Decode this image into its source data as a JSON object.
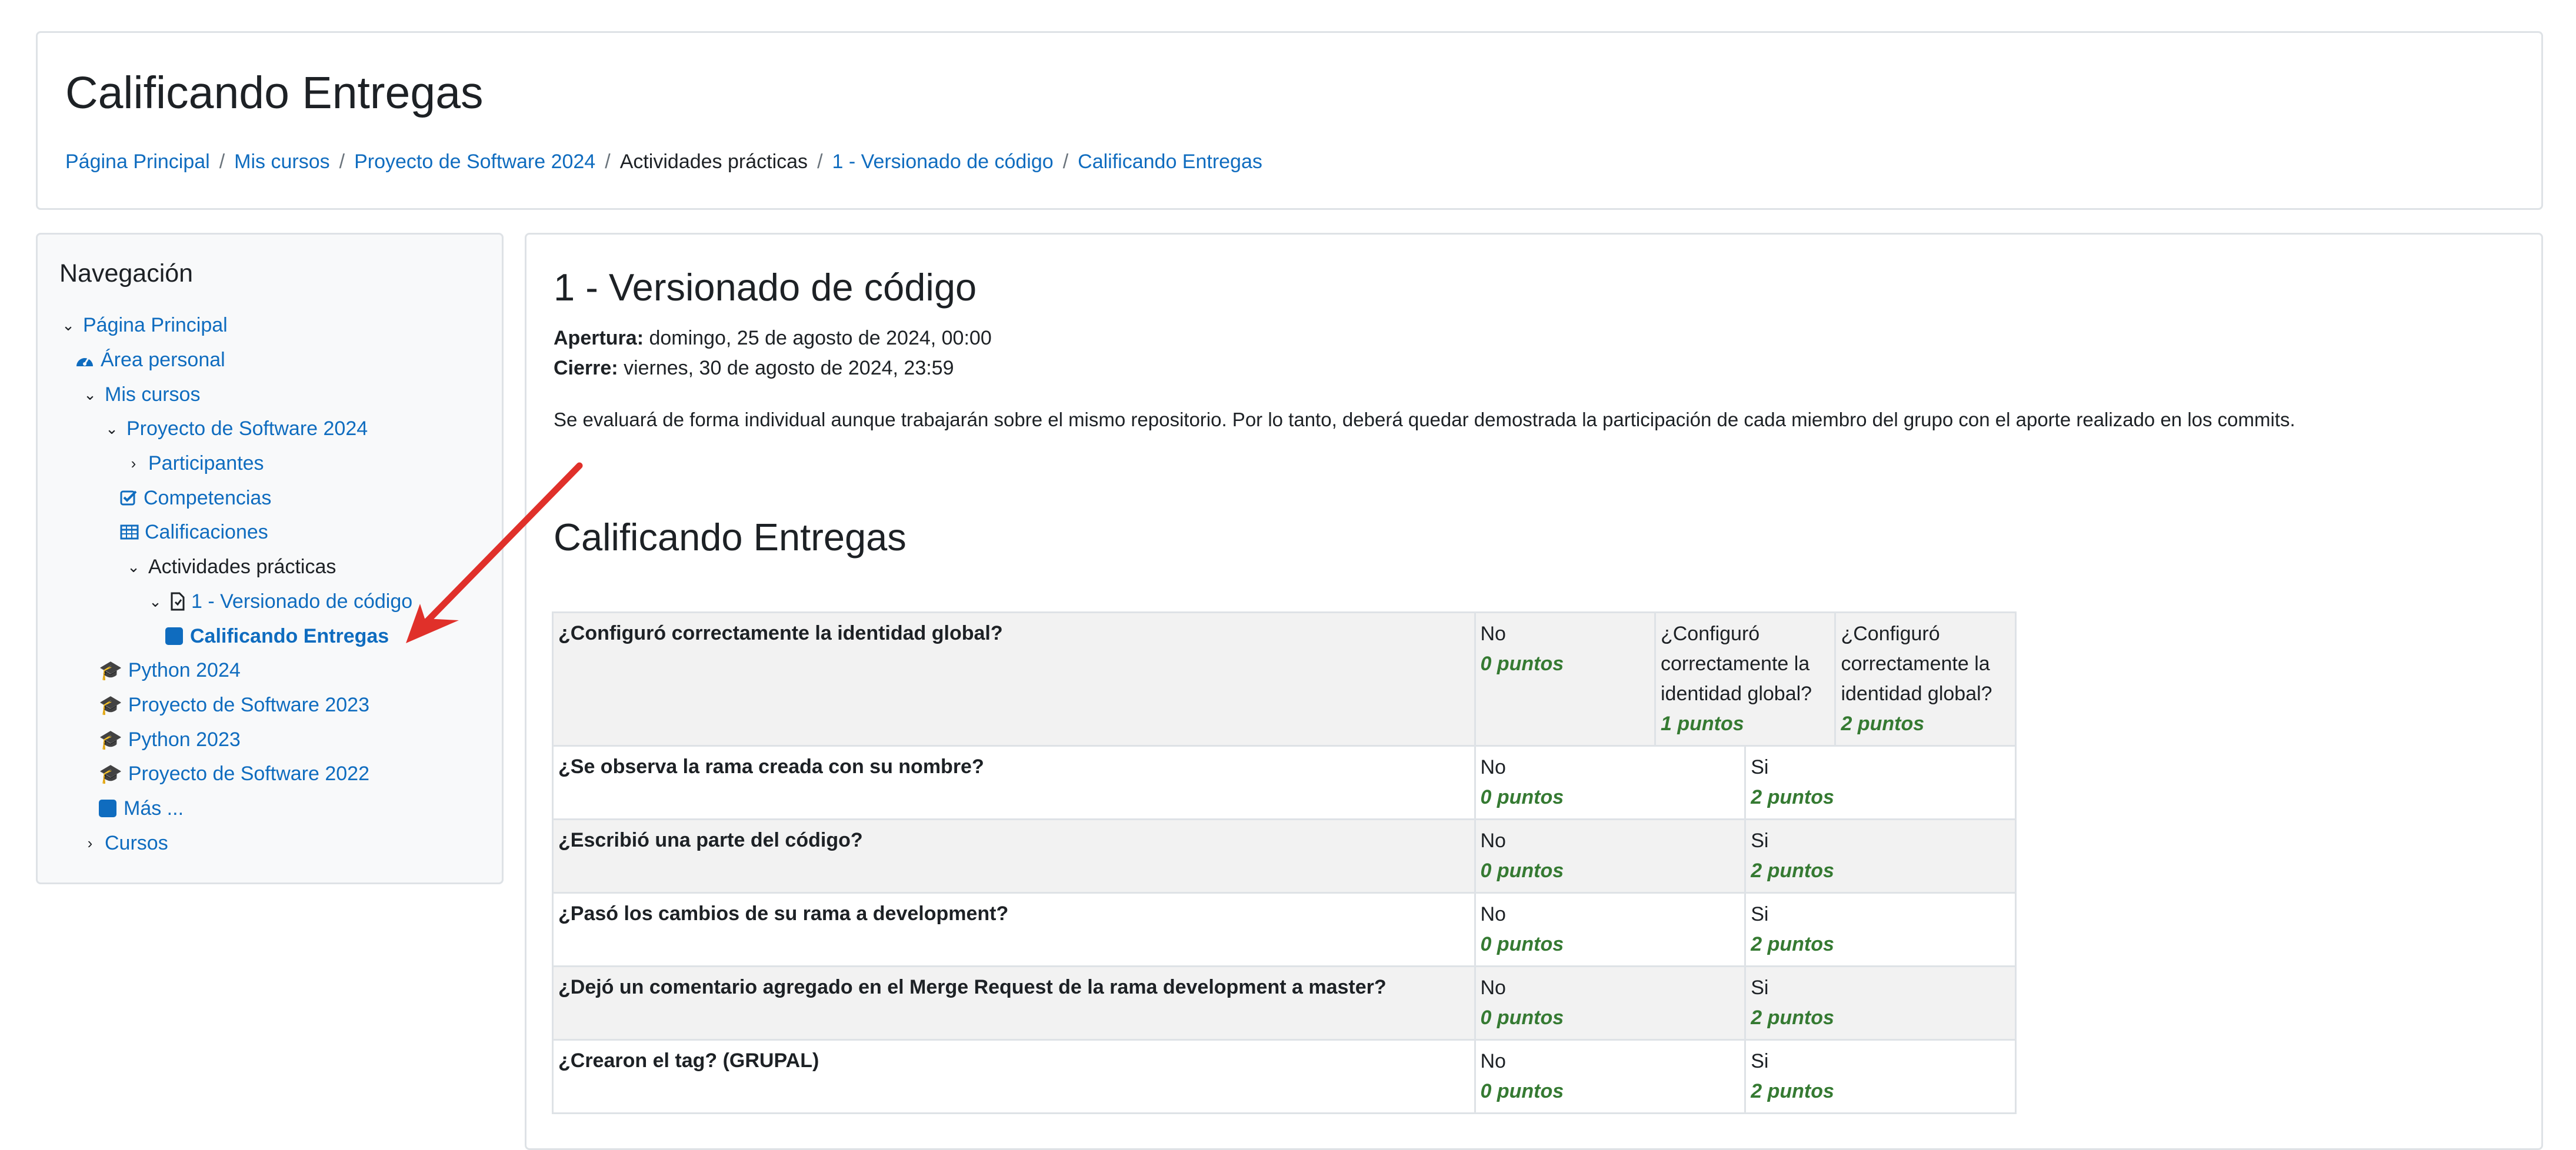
{
  "header": {
    "title": "Calificando Entregas",
    "breadcrumb": [
      {
        "label": "Página Principal",
        "link": true
      },
      {
        "label": "Mis cursos",
        "link": true
      },
      {
        "label": "Proyecto de Software 2024",
        "link": true
      },
      {
        "label": "Actividades prácticas",
        "link": false
      },
      {
        "label": "1 - Versionado de código",
        "link": true
      },
      {
        "label": "Calificando Entregas",
        "link": true
      }
    ]
  },
  "navigation": {
    "title": "Navegación",
    "items": [
      {
        "label": "Página Principal",
        "icon": "chevron-down-icon"
      },
      {
        "label": "Área personal",
        "icon": "dashboard-icon"
      },
      {
        "label": "Mis cursos",
        "icon": "chevron-down-icon"
      },
      {
        "label": "Proyecto de Software 2024",
        "icon": "chevron-down-icon"
      },
      {
        "label": "Participantes",
        "icon": "chevron-right-icon"
      },
      {
        "label": "Competencias",
        "icon": "checkbox-icon"
      },
      {
        "label": "Calificaciones",
        "icon": "table-icon"
      },
      {
        "label": "Actividades prácticas",
        "icon": "chevron-down-icon"
      },
      {
        "label": "1 - Versionado de código",
        "icon": "file-icon"
      },
      {
        "label": "Calificando Entregas",
        "icon": "square-icon"
      },
      {
        "label": "Python 2024",
        "icon": "graduation-cap-icon"
      },
      {
        "label": "Proyecto de Software 2023",
        "icon": "graduation-cap-icon"
      },
      {
        "label": "Python 2023",
        "icon": "graduation-cap-icon"
      },
      {
        "label": "Proyecto de Software 2022",
        "icon": "graduation-cap-icon"
      },
      {
        "label": "Más ...",
        "icon": "square-icon"
      },
      {
        "label": "Cursos",
        "icon": "chevron-right-icon"
      }
    ]
  },
  "activity": {
    "title": "1 - Versionado de código",
    "opening_label": "Apertura:",
    "opening_value": "domingo, 25 de agosto de 2024, 00:00",
    "closing_label": "Cierre:",
    "closing_value": "viernes, 30 de agosto de 2024, 23:59",
    "description": "Se evaluará de forma individual aunque trabajarán sobre el mismo repositorio. Por lo tanto, deberá quedar demostrada la participación de cada miembro del grupo con el aporte realizado en los commits."
  },
  "grading": {
    "title": "Calificando Entregas",
    "criteria": [
      {
        "name": "¿Configuró correctamente la identidad global?",
        "levels": [
          {
            "text": "No",
            "points": "0 puntos"
          },
          {
            "text": "¿Configuró correctamente la identidad global?",
            "points": "1 puntos"
          },
          {
            "text": "¿Configuró correctamente la identidad global?",
            "points": "2 puntos"
          }
        ]
      },
      {
        "name": "¿Se observa la rama creada con su nombre?",
        "levels": [
          {
            "text": "No",
            "points": "0 puntos"
          },
          {
            "text": "Si",
            "points": "2 puntos"
          }
        ]
      },
      {
        "name": "¿Escribió una parte del código?",
        "levels": [
          {
            "text": "No",
            "points": "0 puntos"
          },
          {
            "text": "Si",
            "points": "2 puntos"
          }
        ]
      },
      {
        "name": "¿Pasó los cambios de su rama a development?",
        "levels": [
          {
            "text": "No",
            "points": "0 puntos"
          },
          {
            "text": "Si",
            "points": "2 puntos"
          }
        ]
      },
      {
        "name": "¿Dejó un comentario agregado en el Merge Request de la rama development a master?",
        "levels": [
          {
            "text": "No",
            "points": "0 puntos"
          },
          {
            "text": "Si",
            "points": "2 puntos"
          }
        ]
      },
      {
        "name": "¿Crearon el tag? (GRUPAL)",
        "levels": [
          {
            "text": "No",
            "points": "0 puntos"
          },
          {
            "text": "Si",
            "points": "2 puntos"
          }
        ]
      }
    ]
  },
  "colors": {
    "link": "#0f6cbf",
    "points": "#357a32",
    "annotation_arrow": "#e0302a"
  }
}
